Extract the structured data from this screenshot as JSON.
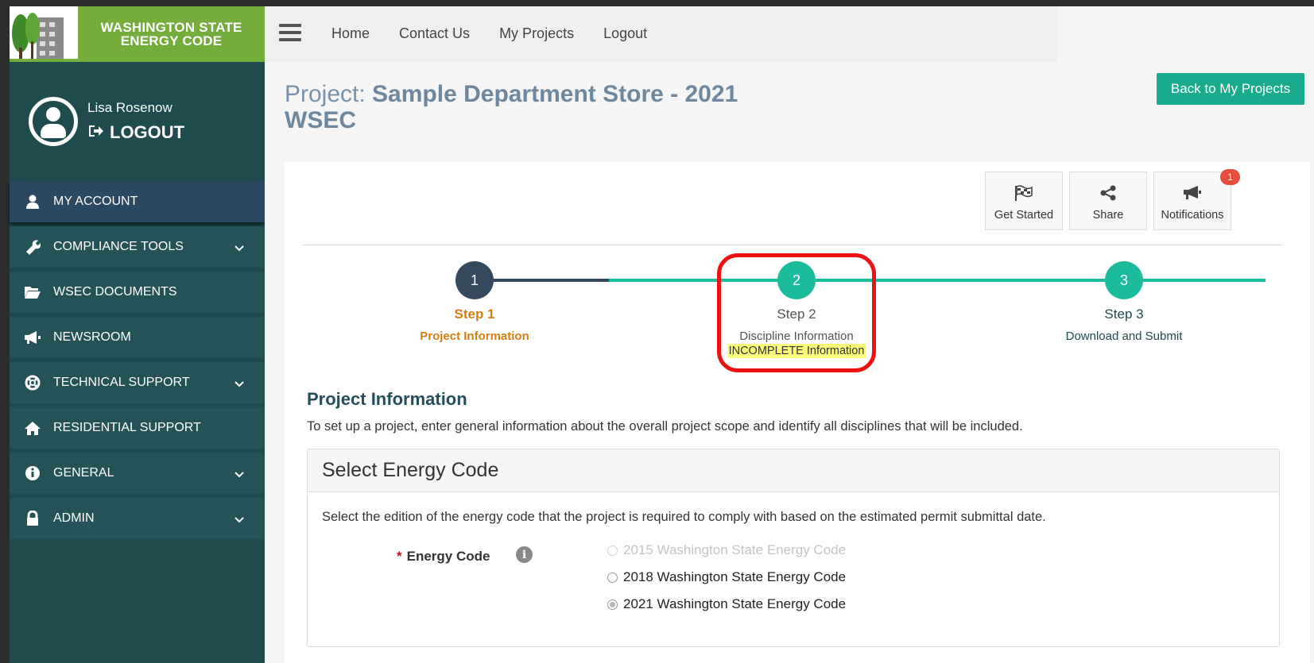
{
  "sidebar": {
    "logo_line1": "WASHINGTON STATE",
    "logo_line2": "ENERGY CODE",
    "user_name": "Lisa Rosenow",
    "logout_label": "LOGOUT",
    "items": [
      {
        "label": "MY ACCOUNT",
        "icon": "user-icon"
      },
      {
        "label": "COMPLIANCE TOOLS",
        "icon": "wrench-icon"
      },
      {
        "label": "WSEC DOCUMENTS",
        "icon": "folder-open-icon"
      },
      {
        "label": "NEWSROOM",
        "icon": "megaphone-icon"
      },
      {
        "label": "TECHNICAL SUPPORT",
        "icon": "life-ring-icon"
      },
      {
        "label": "RESIDENTIAL SUPPORT",
        "icon": "home-icon"
      },
      {
        "label": "GENERAL",
        "icon": "info-circle-icon"
      },
      {
        "label": "ADMIN",
        "icon": "lock-icon"
      }
    ]
  },
  "topnav": {
    "links": [
      "Home",
      "Contact Us",
      "My Projects",
      "Logout"
    ]
  },
  "main": {
    "title_prefix": "Project: ",
    "title_name": "Sample Department Store - 2021 WSEC",
    "back_button": "Back to My Projects",
    "tools": {
      "get_started": "Get Started",
      "share": "Share",
      "notifications": "Notifications",
      "notification_count": "1"
    },
    "steps": [
      {
        "number": "1",
        "title": "Step 1",
        "subtitle": "Project Information",
        "state": "complete"
      },
      {
        "number": "2",
        "title": "Step 2",
        "subtitle": "Discipline Information",
        "status": "INCOMPLETE Information",
        "state": "pending"
      },
      {
        "number": "3",
        "title": "Step 3",
        "subtitle": "Download and Submit",
        "state": "pending"
      }
    ],
    "section_heading": "Project Information",
    "section_desc": "To set up a project, enter general information about the overall project scope and identify all disciplines that will be included.",
    "energy_code": {
      "heading": "Select Energy Code",
      "description": "Select the edition of the energy code that the project is required to comply with based on the estimated permit submittal date.",
      "field_label": "Energy Code",
      "required_mark": "*",
      "info_glyph": "i",
      "options": [
        {
          "label": "2015 Washington State Energy Code",
          "disabled": true,
          "checked": false
        },
        {
          "label": "2018 Washington State Energy Code",
          "disabled": false,
          "checked": false
        },
        {
          "label": "2021 Washington State Energy Code",
          "disabled": false,
          "checked": true
        }
      ]
    }
  },
  "colors": {
    "sidebar_bg": "#1f4a4e",
    "logo_green": "#74ad3c",
    "accent_teal": "#1aaa8e",
    "step1_orange": "#d57f12",
    "step_dark": "#34495e",
    "highlight_red": "#ee1111"
  }
}
